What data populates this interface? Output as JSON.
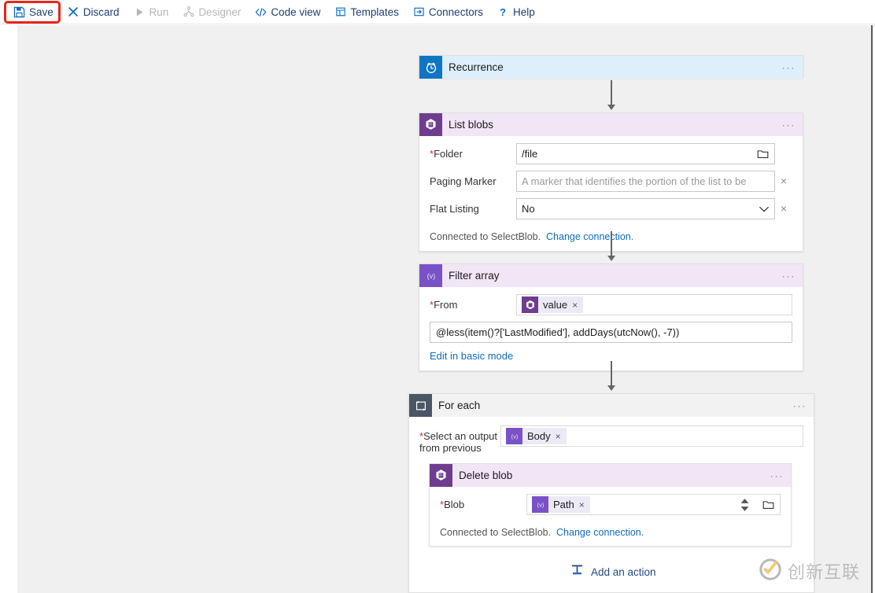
{
  "toolbar": {
    "items": [
      {
        "label": "Save",
        "icon": "save-icon",
        "disabled": false
      },
      {
        "label": "Discard",
        "icon": "close-icon",
        "disabled": false
      },
      {
        "label": "Run",
        "icon": "play-icon",
        "disabled": true
      },
      {
        "label": "Designer",
        "icon": "designer-icon",
        "disabled": true
      },
      {
        "label": "Code view",
        "icon": "code-icon",
        "disabled": false
      },
      {
        "label": "Templates",
        "icon": "templates-icon",
        "disabled": false
      },
      {
        "label": "Connectors",
        "icon": "connectors-icon",
        "disabled": false
      },
      {
        "label": "Help",
        "icon": "help-icon",
        "disabled": false
      }
    ],
    "highlight_color": "#e8251a",
    "highlighted_item": "Save"
  },
  "canvas": {
    "background": "#f0f0f0",
    "recurrence": {
      "title": "Recurrence",
      "icon": "clock-icon",
      "header_color": "#ddeffb",
      "icon_color": "#0f76c4",
      "menu": "···"
    },
    "list_blobs": {
      "title": "List blobs",
      "icon": "blob-storage-icon",
      "header_color": "#f1e6f5",
      "icon_color": "#6f3d8f",
      "menu": "···",
      "fields": [
        {
          "label": "Folder",
          "required": true,
          "value": "/file",
          "placeholder": "",
          "control": "folder-picker"
        },
        {
          "label": "Paging Marker",
          "required": false,
          "value": "",
          "placeholder": "A marker that identifies the portion of the list to be",
          "control": "clear"
        },
        {
          "label": "Flat Listing",
          "required": false,
          "value": "No",
          "placeholder": "",
          "control": "dropdown-clear"
        }
      ],
      "connection_text": "Connected to SelectBlob.",
      "change_connection": "Change connection."
    },
    "filter_array": {
      "title": "Filter array",
      "icon": "expression-icon",
      "header_color": "#f1e6f5",
      "icon_color": "#7a52c7",
      "menu": "···",
      "from_label": "From",
      "from_required": true,
      "from_token": {
        "text": "value",
        "icon": "blob-storage-icon",
        "icon_color": "#6f3d8f",
        "remove": "×"
      },
      "expression": "@less(item()?['LastModified'], addDays(utcNow(), -7))",
      "basic_mode_link": "Edit in basic mode"
    },
    "for_each": {
      "title": "For each",
      "icon": "loop-icon",
      "header_color": "#f2f2f2",
      "icon_color": "#4a5566",
      "menu": "···",
      "select_label_line1": "Select an output",
      "select_label_line2": "from previous",
      "select_required": true,
      "select_token": {
        "text": "Body",
        "icon": "expression-icon",
        "icon_color": "#7a52c7",
        "remove": "×"
      },
      "delete_blob": {
        "title": "Delete blob",
        "icon": "blob-storage-icon",
        "header_color": "#f1e6f5",
        "icon_color": "#6f3d8f",
        "menu": "···",
        "blob_label": "Blob",
        "blob_required": true,
        "blob_token": {
          "text": "Path",
          "icon": "expression-icon",
          "icon_color": "#7a52c7",
          "remove": "×"
        },
        "connection_text": "Connected to SelectBlob.",
        "change_connection": "Change connection."
      },
      "add_action_label": "Add an action",
      "add_action_icon": "insert-action-icon"
    }
  },
  "watermark": {
    "text": "创新互联",
    "icon": "brand-logo-icon"
  }
}
